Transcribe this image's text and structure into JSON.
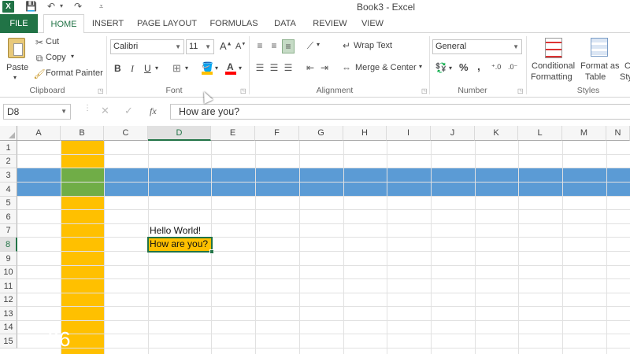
{
  "titlebar": {
    "title": "Book3 - Excel",
    "logo": "X"
  },
  "tabs": [
    {
      "label": "FILE"
    },
    {
      "label": "HOME"
    },
    {
      "label": "INSERT"
    },
    {
      "label": "PAGE LAYOUT"
    },
    {
      "label": "FORMULAS"
    },
    {
      "label": "DATA"
    },
    {
      "label": "REVIEW"
    },
    {
      "label": "VIEW"
    }
  ],
  "ribbon": {
    "clipboard": {
      "paste": "Paste",
      "cut": "Cut",
      "copy": "Copy",
      "format_painter": "Format Painter",
      "label": "Clipboard"
    },
    "font": {
      "name": "Calibri",
      "size": "11",
      "bold": "B",
      "italic": "I",
      "underline": "U",
      "grow": "A",
      "shrink": "A",
      "color_letter": "A",
      "label": "Font"
    },
    "alignment": {
      "wrap_text": "Wrap Text",
      "merge_center": "Merge & Center",
      "label": "Alignment"
    },
    "number": {
      "format": "General",
      "percent": "%",
      "comma": ",",
      "label": "Number"
    },
    "styles": {
      "conditional_1": "Conditional",
      "conditional_2": "Formatting",
      "format_as_1": "Format as",
      "format_as_2": "Table",
      "cell_styles_1": "C",
      "cell_styles_2": "Sty",
      "label": "Styles"
    }
  },
  "formula_bar": {
    "name_box": "D8",
    "fx": "fx",
    "content": "How are you?"
  },
  "columns": [
    "A",
    "B",
    "C",
    "D",
    "E",
    "F",
    "G",
    "H",
    "I",
    "J",
    "K",
    "L",
    "M",
    "N"
  ],
  "rows": [
    "1",
    "2",
    "3",
    "4",
    "5",
    "6",
    "7",
    "8",
    "9",
    "10",
    "11",
    "12",
    "13",
    "14",
    "15"
  ],
  "cells": {
    "D7": "Hello World!",
    "D8": "How are you?"
  },
  "overlay": {
    "timer": "36"
  },
  "colors": {
    "accent": "#217346",
    "column_fill": "#FFC000",
    "row_fill": "#5B9BD5",
    "overlap_fill": "#70AD47",
    "cell_fill": "#FFC000"
  }
}
